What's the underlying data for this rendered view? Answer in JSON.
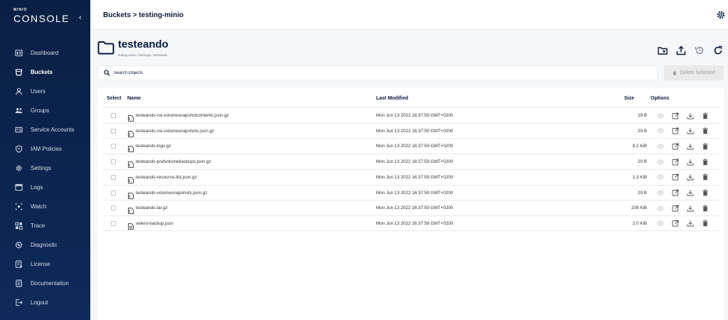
{
  "sidebar": {
    "brand": "MINIO",
    "product": "CONSOLE",
    "items": [
      {
        "label": "Dashboard",
        "icon": "dashboard-icon",
        "active": false
      },
      {
        "label": "Buckets",
        "icon": "bucket-icon",
        "active": true
      },
      {
        "label": "Users",
        "icon": "user-icon",
        "active": false
      },
      {
        "label": "Groups",
        "icon": "groups-icon",
        "active": false
      },
      {
        "label": "Service Accounts",
        "icon": "service-accounts-icon",
        "active": false
      },
      {
        "label": "IAM Policies",
        "icon": "shield-icon",
        "active": false
      },
      {
        "label": "Settings",
        "icon": "gear-icon",
        "active": false
      },
      {
        "label": "Logs",
        "icon": "logs-icon",
        "active": false
      },
      {
        "label": "Watch",
        "icon": "watch-icon",
        "active": false
      },
      {
        "label": "Trace",
        "icon": "trace-icon",
        "active": false
      },
      {
        "label": "Diagnostic",
        "icon": "diagnostic-icon",
        "active": false
      },
      {
        "label": "License",
        "icon": "license-icon",
        "active": false
      },
      {
        "label": "Documentation",
        "icon": "documentation-icon",
        "active": false
      },
      {
        "label": "Logout",
        "icon": "logout-icon",
        "active": false
      }
    ]
  },
  "header": {
    "breadcrumb": "Buckets > testing-minio"
  },
  "bucket": {
    "name": "testeando",
    "path": "testing-minio / backups / testeando"
  },
  "search": {
    "placeholder": "Search Objects"
  },
  "delete_button": "Delete Selected",
  "table": {
    "columns": {
      "select": "Select",
      "name": "Name",
      "modified": "Last Modified",
      "size": "Size",
      "options": "Options"
    },
    "rows": [
      {
        "name": "testeando-csi-volumesnapshotcontents.json.gz",
        "modified": "Mon Jun 13 2022 16:37:59 GMT+0200",
        "size": "29 B"
      },
      {
        "name": "testeando-csi-volumesnapshots.json.gz",
        "modified": "Mon Jun 13 2022 16:37:59 GMT+0200",
        "size": "29 B"
      },
      {
        "name": "testeando-logs.gz",
        "modified": "Mon Jun 13 2022 16:37:59 GMT+0200",
        "size": "8.2 KiB"
      },
      {
        "name": "testeando-podvolumebackups.json.gz",
        "modified": "Mon Jun 13 2022 16:37:59 GMT+0200",
        "size": "29 B"
      },
      {
        "name": "testeando-resource-list.json.gz",
        "modified": "Mon Jun 13 2022 16:37:59 GMT+0200",
        "size": "1.3 KiB"
      },
      {
        "name": "testeando-volumesnapshots.json.gz",
        "modified": "Mon Jun 13 2022 16:37:59 GMT+0200",
        "size": "29 B"
      },
      {
        "name": "testeando.tar.gz",
        "modified": "Mon Jun 13 2022 16:37:59 GMT+0200",
        "size": "208 KiB"
      },
      {
        "name": "velero-backup.json",
        "modified": "Mon Jun 13 2022 16:37:59 GMT+0200",
        "size": "2.0 KiB"
      }
    ]
  }
}
